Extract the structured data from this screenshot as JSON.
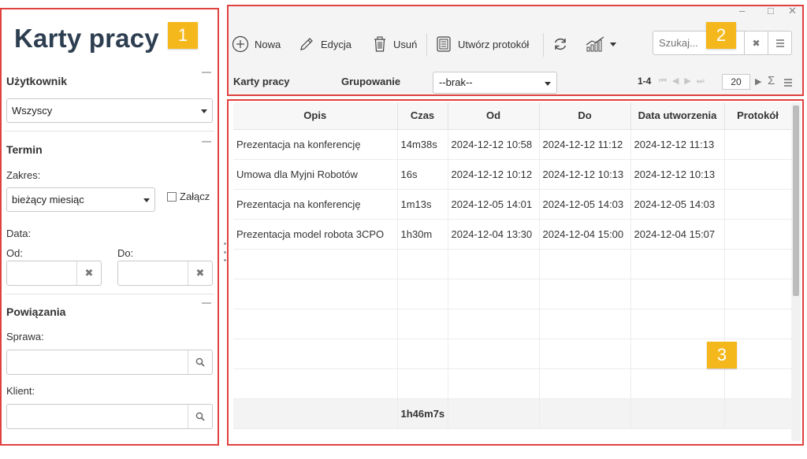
{
  "left_panel": {
    "title": "Karty pracy",
    "badge": "1",
    "user_section": {
      "label": "Użytkownik",
      "select_value": "Wszyscy"
    },
    "term_section": {
      "label": "Termin",
      "range_label": "Zakres:",
      "range_value": "bieżący miesiąc",
      "attach_label": "Załącz",
      "date_label": "Data:",
      "from_label": "Od:",
      "to_label": "Do:"
    },
    "relations_section": {
      "label": "Powiązania",
      "case_label": "Sprawa:",
      "client_label": "Klient:"
    }
  },
  "toolbar": {
    "badge": "2",
    "new_label": "Nowa",
    "edit_label": "Edycja",
    "delete_label": "Usuń",
    "create_protocol_label": "Utwórz protokół",
    "search_placeholder": "Szukaj...",
    "row2_title": "Karty pracy",
    "grouping_label": "Grupowanie",
    "grouping_value": "--brak--",
    "pager_range": "1-4",
    "page_size": "20",
    "window_controls": [
      "–",
      "□",
      "✕"
    ]
  },
  "grid": {
    "badge": "3",
    "columns": [
      "Opis",
      "Czas",
      "Od",
      "Do",
      "Data utworzenia",
      "Protokół"
    ],
    "rows": [
      [
        "Prezentacja na konferencję",
        "14m38s",
        "2024-12-12 10:58",
        "2024-12-12 11:12",
        "2024-12-12 11:13",
        ""
      ],
      [
        "Umowa dla Myjni Robotów",
        "16s",
        "2024-12-12 10:12",
        "2024-12-12 10:13",
        "2024-12-12 10:13",
        ""
      ],
      [
        "Prezentacja na konferencję",
        "1m13s",
        "2024-12-05 14:01",
        "2024-12-05 14:03",
        "2024-12-05 14:03",
        ""
      ],
      [
        "Prezentacja model robota 3CPO",
        "1h30m",
        "2024-12-04 13:30",
        "2024-12-04 15:00",
        "2024-12-04 15:07",
        ""
      ]
    ],
    "empty_rows": 5,
    "footer_total": "1h46m7s"
  },
  "colors": {
    "highlight_border": "#e0413f",
    "badge_bg": "#f5b81c",
    "title_color": "#2d3e50"
  }
}
